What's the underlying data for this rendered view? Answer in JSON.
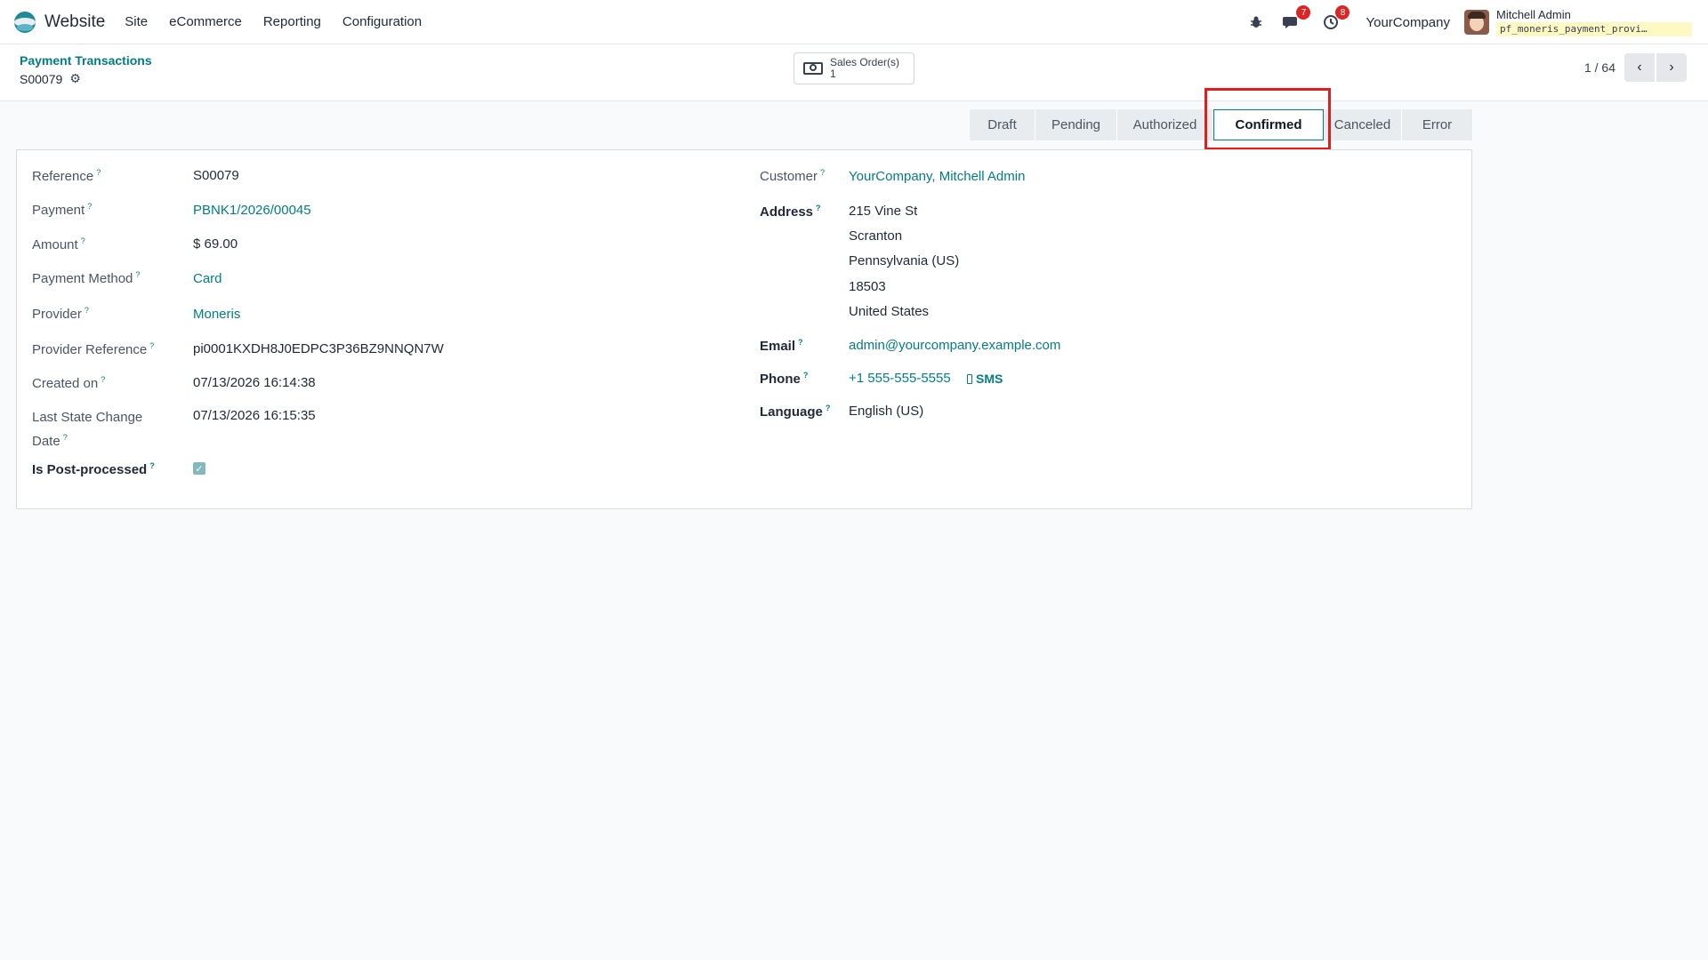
{
  "navbar": {
    "app_name": "Website",
    "menu": [
      "Site",
      "eCommerce",
      "Reporting",
      "Configuration"
    ],
    "messages_count": "7",
    "activities_count": "8",
    "company": "YourCompany",
    "user_name": "Mitchell Admin",
    "database": "pf_moneris_payment_provi…"
  },
  "breadcrumb": {
    "parent": "Payment Transactions",
    "current": "S00079"
  },
  "smart_button": {
    "label": "Sales Order(s)",
    "value": "1"
  },
  "pager": {
    "value": "1 / 64"
  },
  "statusbar": {
    "stages": [
      "Draft",
      "Pending",
      "Authorized",
      "Confirmed",
      "Canceled",
      "Error"
    ],
    "active": "Confirmed"
  },
  "form": {
    "left": {
      "reference_label": "Reference",
      "reference": "S00079",
      "payment_label": "Payment",
      "payment": "PBNK1/2026/00045",
      "amount_label": "Amount",
      "amount": "$ 69.00",
      "payment_method_label": "Payment Method",
      "payment_method": "Card",
      "provider_label": "Provider",
      "provider": "Moneris",
      "provider_reference_label": "Provider Reference",
      "provider_reference": "pi0001KXDH8J0EDPC3P36BZ9NNQN7W",
      "created_on_label": "Created on",
      "created_on": "07/13/2026 16:14:38",
      "last_state_label_1": "Last State Change",
      "last_state_label_2": "Date",
      "last_state": "07/13/2026 16:15:35",
      "post_processed_label": "Is Post-processed",
      "post_processed": true
    },
    "right": {
      "customer_label": "Customer",
      "customer": "YourCompany, Mitchell Admin",
      "address_label": "Address",
      "street": "215 Vine St",
      "city": "Scranton",
      "state": "Pennsylvania (US)",
      "zip": "18503",
      "country": "United States",
      "email_label": "Email",
      "email": "admin@yourcompany.example.com",
      "phone_label": "Phone",
      "phone": "+1 555-555-5555",
      "sms_label": "SMS",
      "language_label": "Language",
      "language": "English (US)"
    },
    "help_mark": "?"
  },
  "colors": {
    "accent": "#017e84",
    "highlight": "#e11d1d"
  }
}
